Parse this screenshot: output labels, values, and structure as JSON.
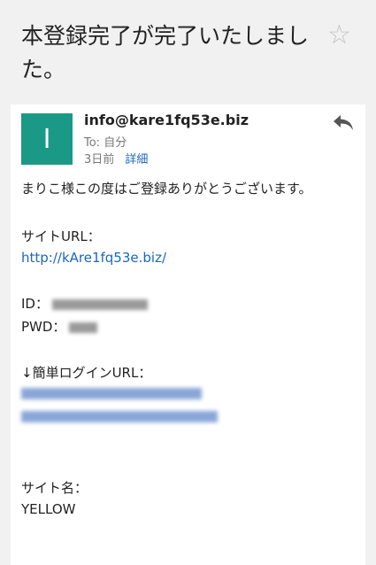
{
  "subject": "本登録完了が完了いたしました。",
  "icons": {
    "star": "star-icon",
    "reply": "reply-icon"
  },
  "sender": {
    "avatar_letter": "I",
    "email": "info@kare1fq53e.biz",
    "to": "To: 自分",
    "date": "3日前",
    "details_label": "詳細"
  },
  "body": {
    "greeting": "まりこ様この度はご登録ありがとうございます。",
    "site_url_label": "サイトURL：",
    "site_url": "http://kAre1fq53e.biz/",
    "id_label": "ID：",
    "pwd_label": "PWD：",
    "login_url_label": "↓簡単ログインURL：",
    "site_name_label": "サイト名：",
    "site_name": "YELLOW"
  },
  "colors": {
    "avatar_bg": "#1a9a86",
    "link": "#1a66c2",
    "background": "#f1f1f1"
  }
}
